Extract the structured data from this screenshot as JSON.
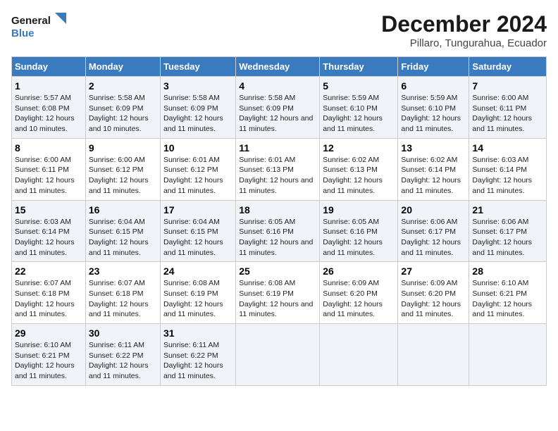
{
  "logo": {
    "line1": "General",
    "line2": "Blue"
  },
  "title": "December 2024",
  "subtitle": "Pillaro, Tungurahua, Ecuador",
  "weekdays": [
    "Sunday",
    "Monday",
    "Tuesday",
    "Wednesday",
    "Thursday",
    "Friday",
    "Saturday"
  ],
  "weeks": [
    [
      {
        "day": "1",
        "sunrise": "Sunrise: 5:57 AM",
        "sunset": "Sunset: 6:08 PM",
        "daylight": "Daylight: 12 hours and 10 minutes."
      },
      {
        "day": "2",
        "sunrise": "Sunrise: 5:58 AM",
        "sunset": "Sunset: 6:09 PM",
        "daylight": "Daylight: 12 hours and 10 minutes."
      },
      {
        "day": "3",
        "sunrise": "Sunrise: 5:58 AM",
        "sunset": "Sunset: 6:09 PM",
        "daylight": "Daylight: 12 hours and 11 minutes."
      },
      {
        "day": "4",
        "sunrise": "Sunrise: 5:58 AM",
        "sunset": "Sunset: 6:09 PM",
        "daylight": "Daylight: 12 hours and 11 minutes."
      },
      {
        "day": "5",
        "sunrise": "Sunrise: 5:59 AM",
        "sunset": "Sunset: 6:10 PM",
        "daylight": "Daylight: 12 hours and 11 minutes."
      },
      {
        "day": "6",
        "sunrise": "Sunrise: 5:59 AM",
        "sunset": "Sunset: 6:10 PM",
        "daylight": "Daylight: 12 hours and 11 minutes."
      },
      {
        "day": "7",
        "sunrise": "Sunrise: 6:00 AM",
        "sunset": "Sunset: 6:11 PM",
        "daylight": "Daylight: 12 hours and 11 minutes."
      }
    ],
    [
      {
        "day": "8",
        "sunrise": "Sunrise: 6:00 AM",
        "sunset": "Sunset: 6:11 PM",
        "daylight": "Daylight: 12 hours and 11 minutes."
      },
      {
        "day": "9",
        "sunrise": "Sunrise: 6:00 AM",
        "sunset": "Sunset: 6:12 PM",
        "daylight": "Daylight: 12 hours and 11 minutes."
      },
      {
        "day": "10",
        "sunrise": "Sunrise: 6:01 AM",
        "sunset": "Sunset: 6:12 PM",
        "daylight": "Daylight: 12 hours and 11 minutes."
      },
      {
        "day": "11",
        "sunrise": "Sunrise: 6:01 AM",
        "sunset": "Sunset: 6:13 PM",
        "daylight": "Daylight: 12 hours and 11 minutes."
      },
      {
        "day": "12",
        "sunrise": "Sunrise: 6:02 AM",
        "sunset": "Sunset: 6:13 PM",
        "daylight": "Daylight: 12 hours and 11 minutes."
      },
      {
        "day": "13",
        "sunrise": "Sunrise: 6:02 AM",
        "sunset": "Sunset: 6:14 PM",
        "daylight": "Daylight: 12 hours and 11 minutes."
      },
      {
        "day": "14",
        "sunrise": "Sunrise: 6:03 AM",
        "sunset": "Sunset: 6:14 PM",
        "daylight": "Daylight: 12 hours and 11 minutes."
      }
    ],
    [
      {
        "day": "15",
        "sunrise": "Sunrise: 6:03 AM",
        "sunset": "Sunset: 6:14 PM",
        "daylight": "Daylight: 12 hours and 11 minutes."
      },
      {
        "day": "16",
        "sunrise": "Sunrise: 6:04 AM",
        "sunset": "Sunset: 6:15 PM",
        "daylight": "Daylight: 12 hours and 11 minutes."
      },
      {
        "day": "17",
        "sunrise": "Sunrise: 6:04 AM",
        "sunset": "Sunset: 6:15 PM",
        "daylight": "Daylight: 12 hours and 11 minutes."
      },
      {
        "day": "18",
        "sunrise": "Sunrise: 6:05 AM",
        "sunset": "Sunset: 6:16 PM",
        "daylight": "Daylight: 12 hours and 11 minutes."
      },
      {
        "day": "19",
        "sunrise": "Sunrise: 6:05 AM",
        "sunset": "Sunset: 6:16 PM",
        "daylight": "Daylight: 12 hours and 11 minutes."
      },
      {
        "day": "20",
        "sunrise": "Sunrise: 6:06 AM",
        "sunset": "Sunset: 6:17 PM",
        "daylight": "Daylight: 12 hours and 11 minutes."
      },
      {
        "day": "21",
        "sunrise": "Sunrise: 6:06 AM",
        "sunset": "Sunset: 6:17 PM",
        "daylight": "Daylight: 12 hours and 11 minutes."
      }
    ],
    [
      {
        "day": "22",
        "sunrise": "Sunrise: 6:07 AM",
        "sunset": "Sunset: 6:18 PM",
        "daylight": "Daylight: 12 hours and 11 minutes."
      },
      {
        "day": "23",
        "sunrise": "Sunrise: 6:07 AM",
        "sunset": "Sunset: 6:18 PM",
        "daylight": "Daylight: 12 hours and 11 minutes."
      },
      {
        "day": "24",
        "sunrise": "Sunrise: 6:08 AM",
        "sunset": "Sunset: 6:19 PM",
        "daylight": "Daylight: 12 hours and 11 minutes."
      },
      {
        "day": "25",
        "sunrise": "Sunrise: 6:08 AM",
        "sunset": "Sunset: 6:19 PM",
        "daylight": "Daylight: 12 hours and 11 minutes."
      },
      {
        "day": "26",
        "sunrise": "Sunrise: 6:09 AM",
        "sunset": "Sunset: 6:20 PM",
        "daylight": "Daylight: 12 hours and 11 minutes."
      },
      {
        "day": "27",
        "sunrise": "Sunrise: 6:09 AM",
        "sunset": "Sunset: 6:20 PM",
        "daylight": "Daylight: 12 hours and 11 minutes."
      },
      {
        "day": "28",
        "sunrise": "Sunrise: 6:10 AM",
        "sunset": "Sunset: 6:21 PM",
        "daylight": "Daylight: 12 hours and 11 minutes."
      }
    ],
    [
      {
        "day": "29",
        "sunrise": "Sunrise: 6:10 AM",
        "sunset": "Sunset: 6:21 PM",
        "daylight": "Daylight: 12 hours and 11 minutes."
      },
      {
        "day": "30",
        "sunrise": "Sunrise: 6:11 AM",
        "sunset": "Sunset: 6:22 PM",
        "daylight": "Daylight: 12 hours and 11 minutes."
      },
      {
        "day": "31",
        "sunrise": "Sunrise: 6:11 AM",
        "sunset": "Sunset: 6:22 PM",
        "daylight": "Daylight: 12 hours and 11 minutes."
      },
      null,
      null,
      null,
      null
    ]
  ]
}
